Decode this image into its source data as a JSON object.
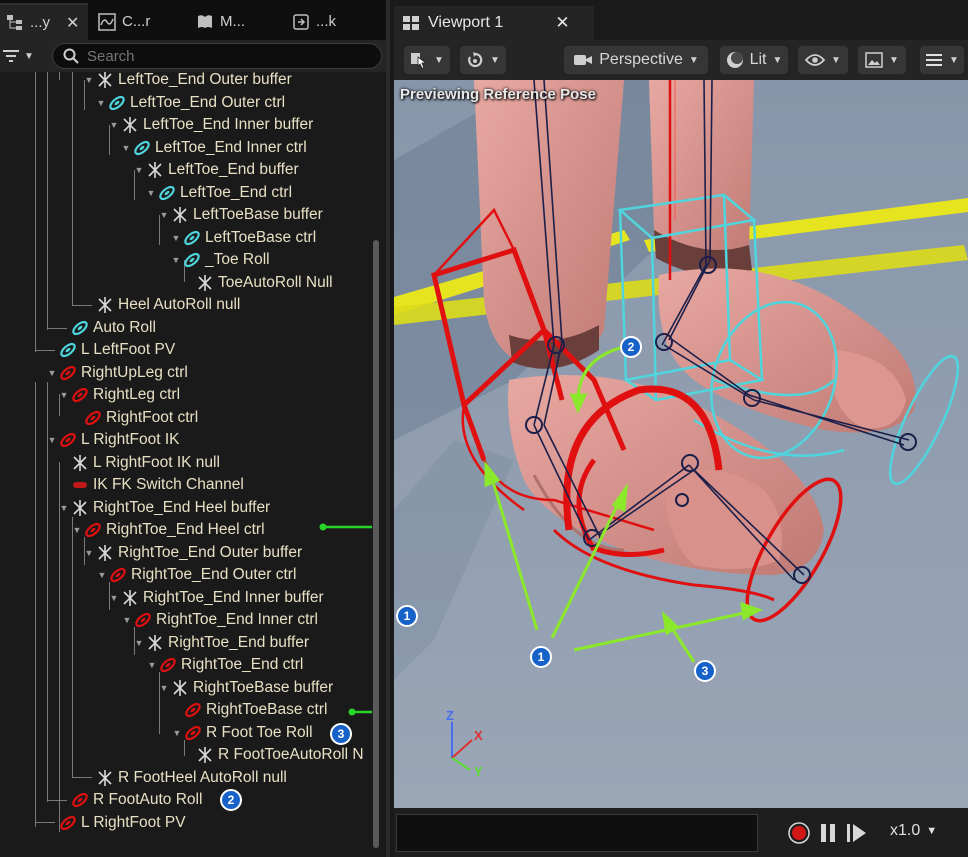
{
  "left_panel": {
    "tabs": [
      {
        "label": "...y",
        "icon": "hierarchy-icon"
      },
      {
        "label": "C...r",
        "icon": "curve-icon"
      },
      {
        "label": "M...",
        "icon": "book-icon"
      },
      {
        "label": "...k",
        "icon": "export-icon"
      }
    ],
    "search": {
      "placeholder": "Search"
    },
    "tree": [
      {
        "label": "LeftToe_End Outer buffer",
        "kind": "null"
      },
      {
        "label": "LeftToe_End Outer ctrl",
        "kind": "ctrl-cyan"
      },
      {
        "label": "LeftToe_End Inner buffer",
        "kind": "null"
      },
      {
        "label": "LeftToe_End Inner ctrl",
        "kind": "ctrl-cyan"
      },
      {
        "label": "LeftToe_End buffer",
        "kind": "null"
      },
      {
        "label": "LeftToe_End ctrl",
        "kind": "ctrl-cyan"
      },
      {
        "label": "LeftToeBase buffer",
        "kind": "null"
      },
      {
        "label": "LeftToeBase ctrl",
        "kind": "ctrl-cyan"
      },
      {
        "label": "_Toe Roll",
        "kind": "ctrl-cyan"
      },
      {
        "label": "ToeAutoRoll Null",
        "kind": "null"
      },
      {
        "label": "Heel AutoRoll null",
        "kind": "null"
      },
      {
        "label": "Auto Roll",
        "kind": "ctrl-cyan"
      },
      {
        "label": "L LeftFoot PV",
        "kind": "ctrl-cyan"
      },
      {
        "label": "RightUpLeg ctrl",
        "kind": "ctrl-red"
      },
      {
        "label": "RightLeg ctrl",
        "kind": "ctrl-red"
      },
      {
        "label": "RightFoot ctrl",
        "kind": "ctrl-red"
      },
      {
        "label": "L RightFoot IK",
        "kind": "ctrl-red"
      },
      {
        "label": "L RightFoot IK null",
        "kind": "null"
      },
      {
        "label": "IK FK Switch Channel",
        "kind": "channel"
      },
      {
        "label": "RightToe_End Heel buffer",
        "kind": "null"
      },
      {
        "label": "RightToe_End Heel ctrl",
        "kind": "ctrl-red"
      },
      {
        "label": "RightToe_End Outer buffer",
        "kind": "null"
      },
      {
        "label": "RightToe_End Outer ctrl",
        "kind": "ctrl-red"
      },
      {
        "label": "RightToe_End Inner buffer",
        "kind": "null"
      },
      {
        "label": "RightToe_End Inner ctrl",
        "kind": "ctrl-red"
      },
      {
        "label": "RightToe_End buffer",
        "kind": "null"
      },
      {
        "label": "RightToe_End ctrl",
        "kind": "ctrl-red"
      },
      {
        "label": "RightToeBase buffer",
        "kind": "null"
      },
      {
        "label": "RightToeBase ctrl",
        "kind": "ctrl-red"
      },
      {
        "label": "R Foot Toe Roll",
        "kind": "ctrl-red"
      },
      {
        "label": "R FootToeAutoRoll N",
        "kind": "null"
      },
      {
        "label": "R FootHeel AutoRoll null",
        "kind": "null"
      },
      {
        "label": "R FootAuto Roll",
        "kind": "ctrl-red"
      },
      {
        "label": "L RightFoot PV",
        "kind": "ctrl-red"
      }
    ],
    "callouts": {
      "toe_roll": "3",
      "auto_roll": "2"
    }
  },
  "viewport": {
    "tab_label": "Viewport 1",
    "perspective_label": "Perspective",
    "lit_label": "Lit",
    "overlay_text": "Previewing Reference Pose",
    "playback_speed": "x1.0",
    "callouts": {
      "left_edge": "1",
      "arrows_origin": "1",
      "rotation_hint": "2",
      "toe_roll_hint": "3"
    },
    "axes": {
      "z": "Z",
      "x": "X",
      "y": "Y"
    }
  },
  "colors": {
    "accent_blue": "#1662c9",
    "callout_green": "#8be82a",
    "bracket_green": "#28d428",
    "control_red": "#e01010",
    "control_cyan": "#4fd5dd"
  }
}
